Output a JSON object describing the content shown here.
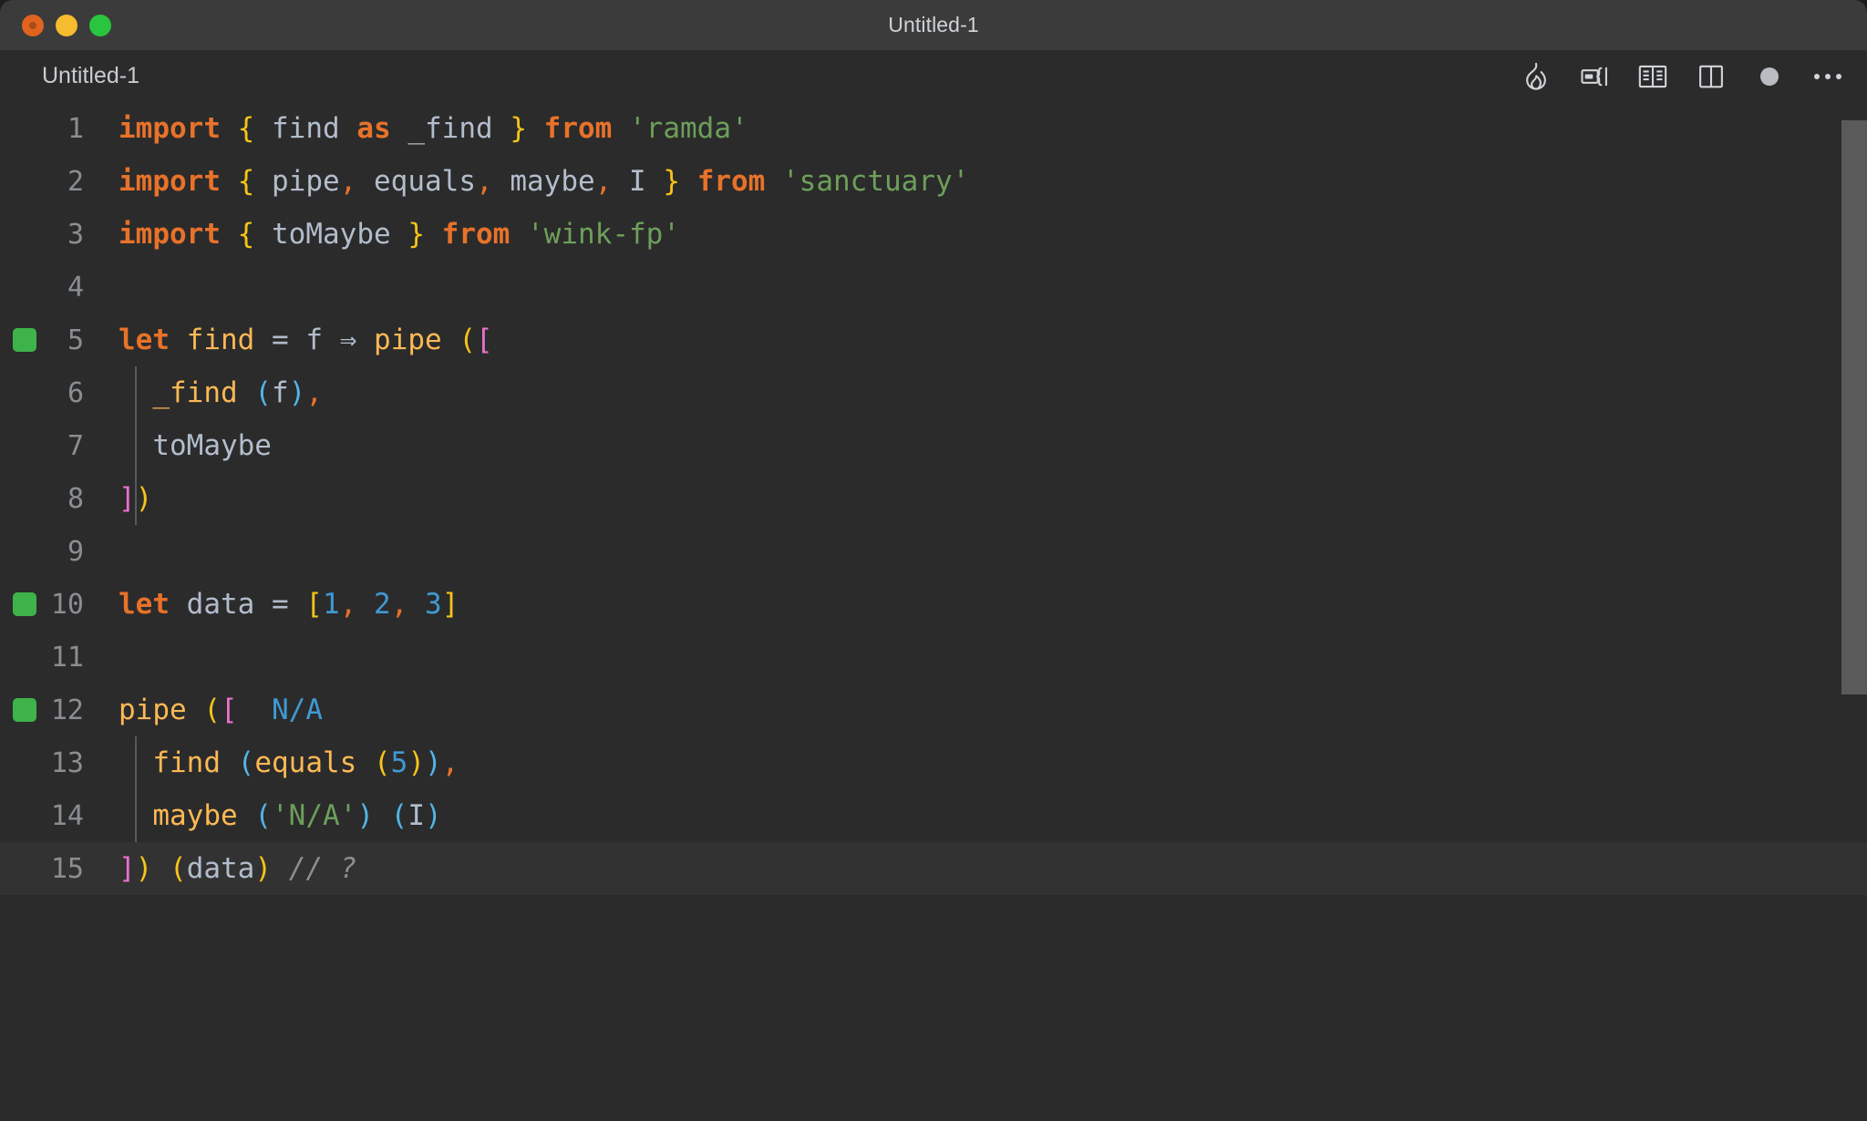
{
  "window": {
    "title": "Untitled-1",
    "traffic_lights": [
      "close",
      "minimize",
      "maximize"
    ]
  },
  "editor_header": {
    "tab_name": "Untitled-1",
    "actions": [
      {
        "name": "quokka-run-icon",
        "label": "Run Quokka"
      },
      {
        "name": "run-code-icon",
        "label": "Run Code"
      },
      {
        "name": "open-preview-icon",
        "label": "Open Preview"
      },
      {
        "name": "split-editor-icon",
        "label": "Split Editor"
      },
      {
        "name": "unsaved-dot-icon",
        "label": "Unsaved changes"
      },
      {
        "name": "more-actions-icon",
        "label": "More Actions..."
      }
    ]
  },
  "code": {
    "language": "javascript",
    "total_lines": 15,
    "active_line": 15,
    "breakpoint_lines": [
      5,
      10,
      12
    ],
    "lines": [
      {
        "number": "1",
        "marker": false,
        "tokens": [
          {
            "t": "import",
            "c": "t-kw"
          },
          {
            "t": " ",
            "c": "t-op"
          },
          {
            "t": "{",
            "c": "t-brace"
          },
          {
            "t": " ",
            "c": "t-op"
          },
          {
            "t": "find",
            "c": "t-var"
          },
          {
            "t": " ",
            "c": "t-op"
          },
          {
            "t": "as",
            "c": "t-kw"
          },
          {
            "t": " ",
            "c": "t-op"
          },
          {
            "t": "_find",
            "c": "t-var"
          },
          {
            "t": " ",
            "c": "t-op"
          },
          {
            "t": "}",
            "c": "t-brace"
          },
          {
            "t": " ",
            "c": "t-op"
          },
          {
            "t": "from",
            "c": "t-kw"
          },
          {
            "t": " ",
            "c": "t-op"
          },
          {
            "t": "'ramda'",
            "c": "t-str"
          }
        ]
      },
      {
        "number": "2",
        "marker": false,
        "tokens": [
          {
            "t": "import",
            "c": "t-kw"
          },
          {
            "t": " ",
            "c": "t-op"
          },
          {
            "t": "{",
            "c": "t-brace"
          },
          {
            "t": " ",
            "c": "t-op"
          },
          {
            "t": "pipe",
            "c": "t-var"
          },
          {
            "t": ",",
            "c": "t-comma"
          },
          {
            "t": " ",
            "c": "t-op"
          },
          {
            "t": "equals",
            "c": "t-var"
          },
          {
            "t": ",",
            "c": "t-comma"
          },
          {
            "t": " ",
            "c": "t-op"
          },
          {
            "t": "maybe",
            "c": "t-var"
          },
          {
            "t": ",",
            "c": "t-comma"
          },
          {
            "t": " ",
            "c": "t-op"
          },
          {
            "t": "I",
            "c": "t-var"
          },
          {
            "t": " ",
            "c": "t-op"
          },
          {
            "t": "}",
            "c": "t-brace"
          },
          {
            "t": " ",
            "c": "t-op"
          },
          {
            "t": "from",
            "c": "t-kw"
          },
          {
            "t": " ",
            "c": "t-op"
          },
          {
            "t": "'sanctuary'",
            "c": "t-str"
          }
        ]
      },
      {
        "number": "3",
        "marker": false,
        "tokens": [
          {
            "t": "import",
            "c": "t-kw"
          },
          {
            "t": " ",
            "c": "t-op"
          },
          {
            "t": "{",
            "c": "t-brace"
          },
          {
            "t": " ",
            "c": "t-op"
          },
          {
            "t": "toMaybe",
            "c": "t-var"
          },
          {
            "t": " ",
            "c": "t-op"
          },
          {
            "t": "}",
            "c": "t-brace"
          },
          {
            "t": " ",
            "c": "t-op"
          },
          {
            "t": "from",
            "c": "t-kw"
          },
          {
            "t": " ",
            "c": "t-op"
          },
          {
            "t": "'wink-fp'",
            "c": "t-str"
          }
        ]
      },
      {
        "number": "4",
        "marker": false,
        "tokens": []
      },
      {
        "number": "5",
        "marker": true,
        "tokens": [
          {
            "t": "let",
            "c": "t-kw"
          },
          {
            "t": " ",
            "c": "t-op"
          },
          {
            "t": "find",
            "c": "t-fn"
          },
          {
            "t": " ",
            "c": "t-op"
          },
          {
            "t": "=",
            "c": "t-op"
          },
          {
            "t": " ",
            "c": "t-op"
          },
          {
            "t": "f",
            "c": "t-var"
          },
          {
            "t": " ",
            "c": "t-op"
          },
          {
            "t": "⇒",
            "c": "t-arrow"
          },
          {
            "t": " ",
            "c": "t-op"
          },
          {
            "t": "pipe",
            "c": "t-fn"
          },
          {
            "t": " ",
            "c": "t-op"
          },
          {
            "t": "(",
            "c": "t-paren1"
          },
          {
            "t": "[",
            "c": "t-bracket"
          }
        ]
      },
      {
        "number": "6",
        "marker": false,
        "indent": true,
        "tokens": [
          {
            "t": "  ",
            "c": "t-op"
          },
          {
            "t": "_find",
            "c": "t-fn"
          },
          {
            "t": " ",
            "c": "t-op"
          },
          {
            "t": "(",
            "c": "t-paren2"
          },
          {
            "t": "f",
            "c": "t-var"
          },
          {
            "t": ")",
            "c": "t-paren2"
          },
          {
            "t": ",",
            "c": "t-comma"
          }
        ]
      },
      {
        "number": "7",
        "marker": false,
        "indent": true,
        "tokens": [
          {
            "t": "  ",
            "c": "t-op"
          },
          {
            "t": "toMaybe",
            "c": "t-var"
          }
        ]
      },
      {
        "number": "8",
        "marker": false,
        "tokens": [
          {
            "t": "]",
            "c": "t-bracket"
          },
          {
            "t": ")",
            "c": "t-paren1"
          }
        ]
      },
      {
        "number": "9",
        "marker": false,
        "tokens": []
      },
      {
        "number": "10",
        "marker": true,
        "tokens": [
          {
            "t": "let",
            "c": "t-kw"
          },
          {
            "t": " ",
            "c": "t-op"
          },
          {
            "t": "data",
            "c": "t-var"
          },
          {
            "t": " ",
            "c": "t-op"
          },
          {
            "t": "=",
            "c": "t-op"
          },
          {
            "t": " ",
            "c": "t-op"
          },
          {
            "t": "[",
            "c": "t-paren1"
          },
          {
            "t": "1",
            "c": "t-num"
          },
          {
            "t": ",",
            "c": "t-comma"
          },
          {
            "t": " ",
            "c": "t-op"
          },
          {
            "t": "2",
            "c": "t-num"
          },
          {
            "t": ",",
            "c": "t-comma"
          },
          {
            "t": " ",
            "c": "t-op"
          },
          {
            "t": "3",
            "c": "t-num"
          },
          {
            "t": "]",
            "c": "t-paren1"
          }
        ]
      },
      {
        "number": "11",
        "marker": false,
        "tokens": []
      },
      {
        "number": "12",
        "marker": true,
        "tokens": [
          {
            "t": "pipe",
            "c": "t-fn"
          },
          {
            "t": " ",
            "c": "t-op"
          },
          {
            "t": "(",
            "c": "t-paren1"
          },
          {
            "t": "[",
            "c": "t-bracket"
          },
          {
            "t": "  ",
            "c": "t-op"
          },
          {
            "t": "N/A",
            "c": "t-annot"
          }
        ]
      },
      {
        "number": "13",
        "marker": false,
        "indent": true,
        "tokens": [
          {
            "t": "  ",
            "c": "t-op"
          },
          {
            "t": "find",
            "c": "t-fn"
          },
          {
            "t": " ",
            "c": "t-op"
          },
          {
            "t": "(",
            "c": "t-paren2"
          },
          {
            "t": "equals",
            "c": "t-fn"
          },
          {
            "t": " ",
            "c": "t-op"
          },
          {
            "t": "(",
            "c": "t-paren1"
          },
          {
            "t": "5",
            "c": "t-num"
          },
          {
            "t": ")",
            "c": "t-paren1"
          },
          {
            "t": ")",
            "c": "t-paren2"
          },
          {
            "t": ",",
            "c": "t-comma"
          }
        ]
      },
      {
        "number": "14",
        "marker": false,
        "indent": true,
        "tokens": [
          {
            "t": "  ",
            "c": "t-op"
          },
          {
            "t": "maybe",
            "c": "t-fn"
          },
          {
            "t": " ",
            "c": "t-op"
          },
          {
            "t": "(",
            "c": "t-paren2"
          },
          {
            "t": "'N/A'",
            "c": "t-str"
          },
          {
            "t": ")",
            "c": "t-paren2"
          },
          {
            "t": " ",
            "c": "t-op"
          },
          {
            "t": "(",
            "c": "t-paren2"
          },
          {
            "t": "I",
            "c": "t-var"
          },
          {
            "t": ")",
            "c": "t-paren2"
          }
        ]
      },
      {
        "number": "15",
        "marker": false,
        "active": true,
        "tokens": [
          {
            "t": "]",
            "c": "t-bracket"
          },
          {
            "t": ")",
            "c": "t-paren1"
          },
          {
            "t": " ",
            "c": "t-op"
          },
          {
            "t": "(",
            "c": "t-paren1"
          },
          {
            "t": "data",
            "c": "t-var"
          },
          {
            "t": ")",
            "c": "t-paren1"
          },
          {
            "t": " ",
            "c": "t-op"
          },
          {
            "t": "// ?",
            "c": "t-comment"
          }
        ]
      }
    ]
  },
  "colors": {
    "window_chrome": "#3b3b3b",
    "editor_background": "#2b2b2b",
    "active_line": "#323232",
    "keyword": "#e8722a",
    "function": "#fcb954",
    "variable": "#b2bdcc",
    "string": "#6d9f5a",
    "number": "#3f9ad4",
    "brace": "#f6c419",
    "bracket": "#e872cf",
    "paren_cyan": "#52b5e8",
    "comment": "#8a8e92",
    "marker_green": "#3eb34a",
    "scrollbar": "#5a5a5a"
  },
  "scrollbar": {
    "visible": true
  }
}
